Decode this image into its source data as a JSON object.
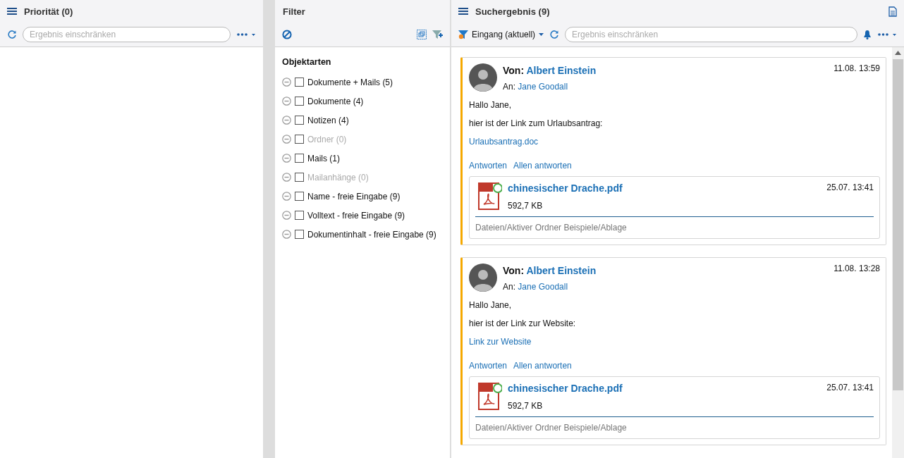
{
  "priority_panel": {
    "title": "Priorität (0)",
    "search": {
      "placeholder": "Ergebnis einschränken"
    }
  },
  "filter_panel": {
    "title": "Filter",
    "section_title": "Objektarten",
    "items": [
      {
        "label": "Dokumente + Mails (5)",
        "checked": false,
        "disabled": false
      },
      {
        "label": "Dokumente (4)",
        "checked": false,
        "disabled": false
      },
      {
        "label": "Notizen (4)",
        "checked": false,
        "disabled": false
      },
      {
        "label": "Ordner (0)",
        "checked": false,
        "disabled": true
      },
      {
        "label": "Mails (1)",
        "checked": false,
        "disabled": false
      },
      {
        "label": "Mailanhänge (0)",
        "checked": false,
        "disabled": true
      },
      {
        "label": "Name - freie Eingabe (9)",
        "checked": false,
        "disabled": false
      },
      {
        "label": "Volltext - freie Eingabe (9)",
        "checked": false,
        "disabled": false
      },
      {
        "label": "Dokumentinhalt - freie Eingabe (9)",
        "checked": false,
        "disabled": false
      }
    ]
  },
  "results_panel": {
    "title": "Suchergebnis (9)",
    "folder_dropdown": "Eingang (aktuell)",
    "search": {
      "placeholder": "Ergebnis einschränken"
    },
    "mails": [
      {
        "from_label": "Von:",
        "from": "Albert Einstein",
        "to_label": "An:",
        "to": "Jane Goodall",
        "date": "11.08. 13:59",
        "greeting": "Hallo Jane,",
        "text": "hier ist der Link zum Urlaubsantrag:",
        "link": "Urlaubsantrag.doc",
        "actions": [
          "Antworten",
          "Allen antworten"
        ],
        "attachment": {
          "name": "chinesischer Drache.pdf",
          "size": "592,7 KB",
          "date": "25.07. 13:41",
          "path": "Dateien/Aktiver Ordner Beispiele/Ablage"
        }
      },
      {
        "from_label": "Von:",
        "from": "Albert Einstein",
        "to_label": "An:",
        "to": "Jane Goodall",
        "date": "11.08. 13:28",
        "greeting": "Hallo Jane,",
        "text": "hier ist der Link zur Website:",
        "link": "Link zur Website",
        "actions": [
          "Antworten",
          "Allen antworten"
        ],
        "attachment": {
          "name": "chinesischer Drache.pdf",
          "size": "592,7 KB",
          "date": "25.07. 13:41",
          "path": "Dateien/Aktiver Ordner Beispiele/Ablage"
        }
      }
    ]
  }
}
